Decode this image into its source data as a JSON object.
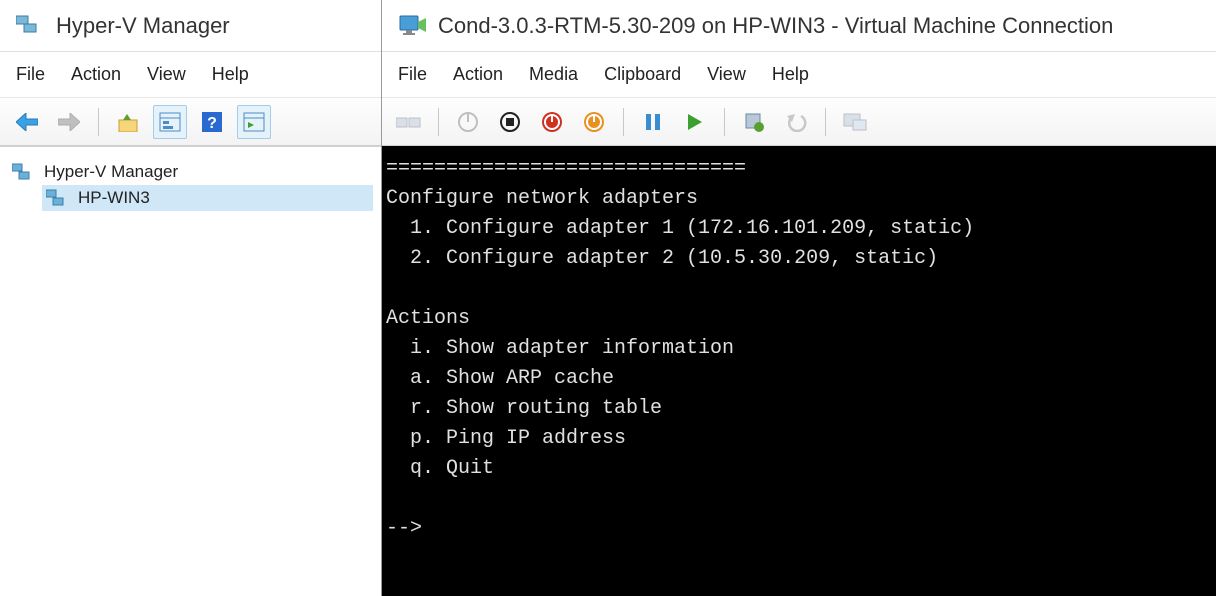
{
  "left": {
    "title": "Hyper-V Manager",
    "menu": [
      "File",
      "Action",
      "View",
      "Help"
    ],
    "tree": {
      "root": "Hyper-V Manager",
      "child": "HP-WIN3"
    }
  },
  "right": {
    "title": "Cond-3.0.3-RTM-5.30-209 on HP-WIN3 - Virtual Machine Connection",
    "menu": [
      "File",
      "Action",
      "Media",
      "Clipboard",
      "View",
      "Help"
    ],
    "console": "==============================\nConfigure network adapters\n  1. Configure adapter 1 (172.16.101.209, static)\n  2. Configure adapter 2 (10.5.30.209, static)\n\nActions\n  i. Show adapter information\n  a. Show ARP cache\n  r. Show routing table\n  p. Ping IP address\n  q. Quit\n\n-->"
  }
}
